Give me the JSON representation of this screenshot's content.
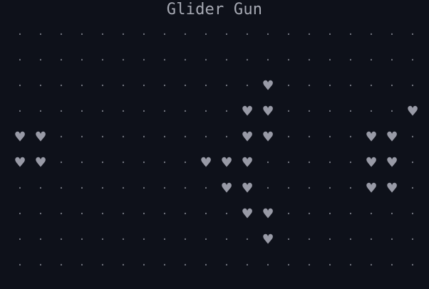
{
  "title": "Glider Gun",
  "glyphs": {
    "alive": "♥",
    "dead": "·"
  },
  "colors": {
    "background": "#0e111a",
    "alive": "#989aa6",
    "dead": "#7d808a",
    "title": "#a6a9b3"
  },
  "board": {
    "columns": 20,
    "rows": 10,
    "cells": [
      "....................",
      "....................",
      "............#.......",
      "...........##......#",
      "##.........##....##.",
      "##.......###.....##.",
      "..........##.....##.",
      "...........##.......",
      "............#.......",
      "...................."
    ]
  }
}
